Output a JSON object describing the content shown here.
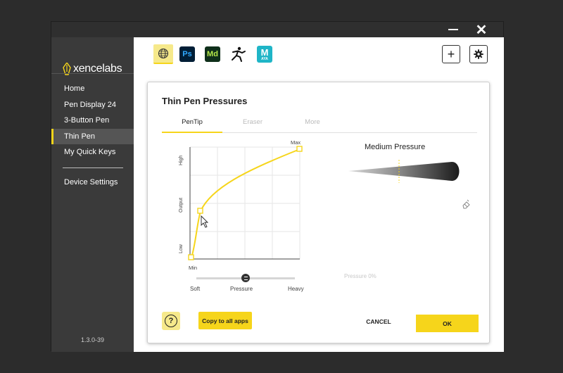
{
  "window": {
    "minimize_label": "",
    "close_label": "✕"
  },
  "sidebar": {
    "logo_text": "xencelabs",
    "items": [
      {
        "label": "Home"
      },
      {
        "label": "Pen Display 24"
      },
      {
        "label": "3-Button Pen"
      },
      {
        "label": "Thin Pen",
        "active": true
      },
      {
        "label": "My Quick Keys"
      }
    ],
    "device_settings_label": "Device Settings",
    "version": "1.3.0-39"
  },
  "app_bar": {
    "apps": [
      {
        "name": "global",
        "icon": "globe-icon",
        "selected": true
      },
      {
        "name": "Photoshop",
        "icon": "ps-icon",
        "text": "Ps"
      },
      {
        "name": "Substance Modeler",
        "icon": "md-icon",
        "text": "Md"
      },
      {
        "name": "ZBrush",
        "icon": "zbrush-icon"
      },
      {
        "name": "Maya",
        "icon": "maya-icon",
        "text": "M",
        "subtext": "AYA"
      }
    ],
    "add_label": "+",
    "settings_icon": "gear-icon"
  },
  "panel": {
    "title": "Thin Pen Pressures",
    "tabs": [
      {
        "label": "PenTip",
        "active": true
      },
      {
        "label": "Eraser",
        "active": false
      },
      {
        "label": "More",
        "active": false
      }
    ],
    "curve": {
      "x_min_label": "Min",
      "x_max_label": "Max",
      "y_labels": {
        "low": "Low",
        "mid": "Output",
        "high": "High"
      },
      "accent": "#f6d51b"
    },
    "slider": {
      "soft_label": "Soft",
      "mid_label": "Pressure",
      "heavy_label": "Heavy",
      "value_fraction": 0.5
    },
    "preview": {
      "title": "Medium Pressure",
      "pressure_readout": "Pressure   0%"
    },
    "footer": {
      "help_label": "?",
      "copy_label": "Copy to all apps",
      "cancel_label": "CANCEL",
      "ok_label": "OK"
    }
  },
  "colors": {
    "accent": "#f6d51b",
    "accent_light": "#f6e98b",
    "sidebar_bg": "#3a3a3a",
    "window_bg": "#2f2f2f"
  }
}
